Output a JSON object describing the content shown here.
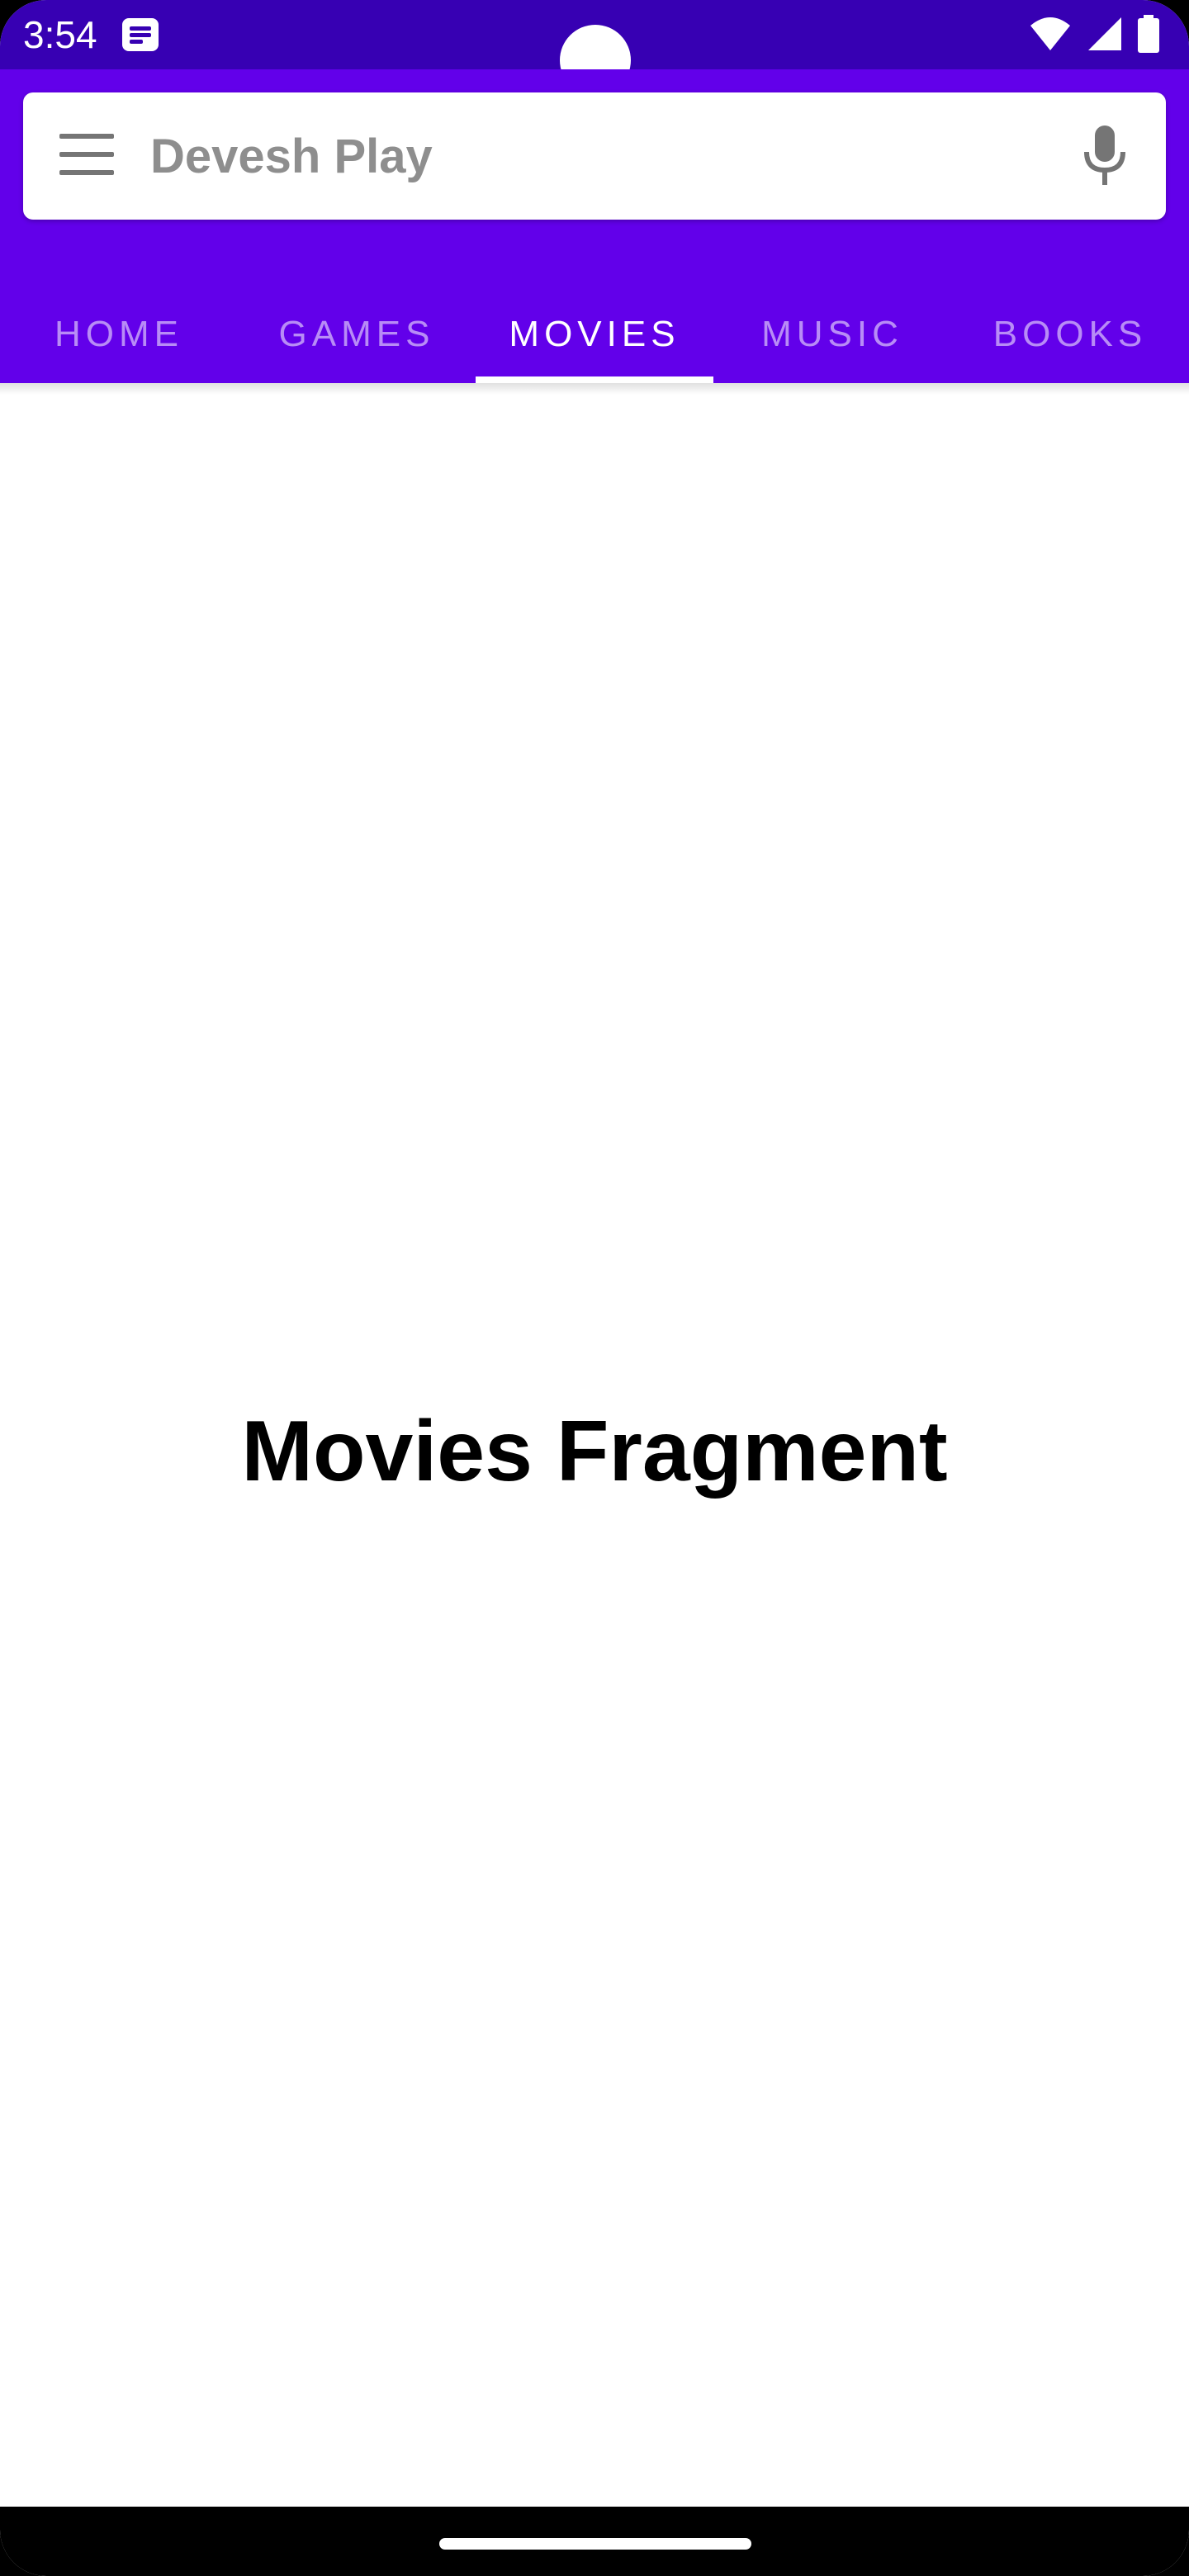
{
  "status_bar": {
    "time": "3:54",
    "notification_icon": "message-notification-icon",
    "wifi_icon": "wifi-icon",
    "signal_icon": "cell-signal-icon",
    "battery_icon": "battery-icon"
  },
  "search_bar": {
    "title": "Devesh Play",
    "menu_icon": "hamburger-menu-icon",
    "mic_icon": "microphone-icon"
  },
  "tabs": [
    {
      "label": "HOME",
      "active": false
    },
    {
      "label": "GAMES",
      "active": false
    },
    {
      "label": "MOVIES",
      "active": true
    },
    {
      "label": "MUSIC",
      "active": false
    },
    {
      "label": "BOOKS",
      "active": false
    }
  ],
  "content": {
    "label": "Movies Fragment"
  },
  "colors": {
    "status_bar": "#3700b3",
    "app_bar": "#6200ea",
    "tab_active": "#ffffff",
    "tab_inactive": "#b79cf5"
  }
}
